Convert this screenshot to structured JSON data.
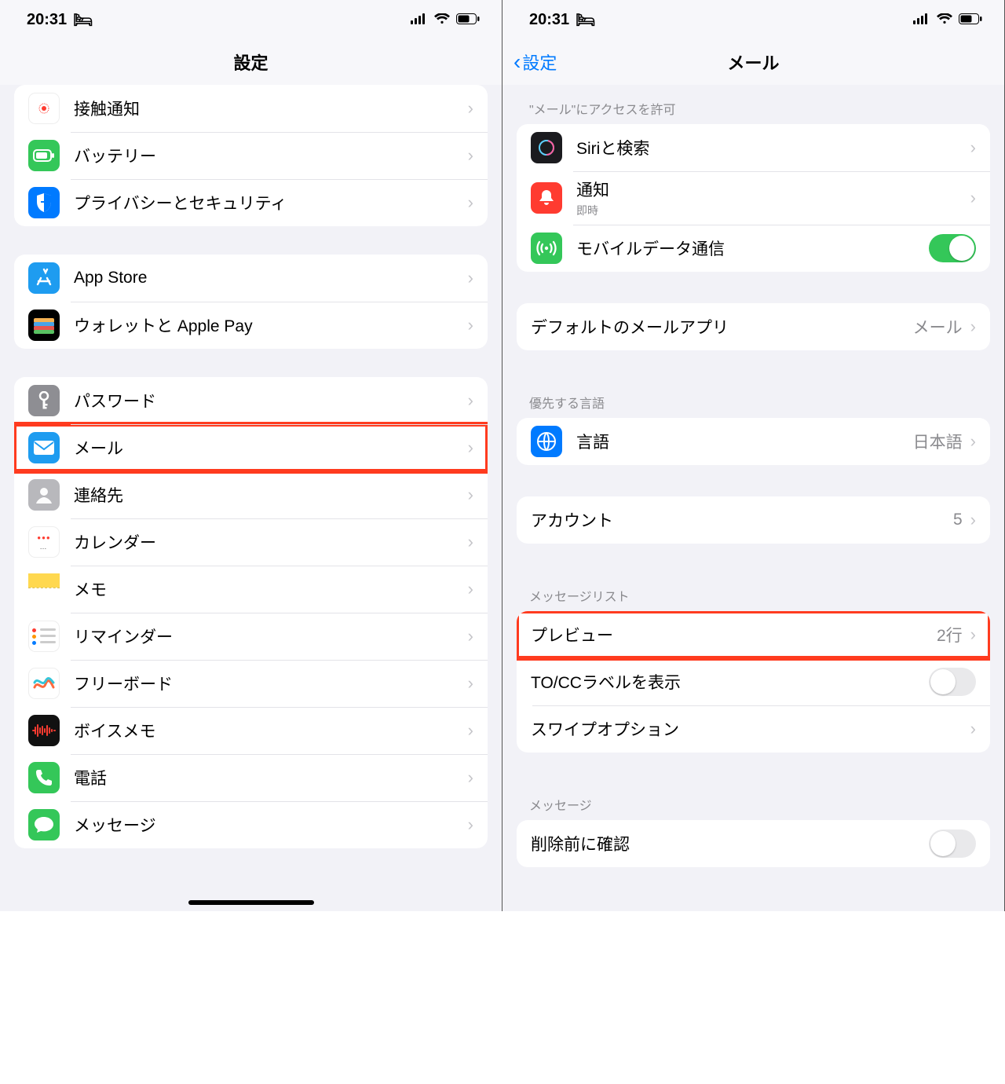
{
  "status": {
    "time": "20:31"
  },
  "left": {
    "title": "設定",
    "groups": [
      {
        "rows": [
          {
            "icon": "exposure",
            "label": "接触通知"
          },
          {
            "icon": "battery",
            "label": "バッテリー"
          },
          {
            "icon": "privacy",
            "label": "プライバシーとセキュリティ"
          }
        ]
      },
      {
        "rows": [
          {
            "icon": "appstore",
            "label": "App Store"
          },
          {
            "icon": "wallet",
            "label": "ウォレットと Apple Pay"
          }
        ]
      },
      {
        "rows": [
          {
            "icon": "passwords",
            "label": "パスワード"
          },
          {
            "icon": "mail",
            "label": "メール",
            "highlight": true
          },
          {
            "icon": "contacts",
            "label": "連絡先"
          },
          {
            "icon": "calendar",
            "label": "カレンダー"
          },
          {
            "icon": "notes",
            "label": "メモ"
          },
          {
            "icon": "reminders",
            "label": "リマインダー"
          },
          {
            "icon": "freeform",
            "label": "フリーボード"
          },
          {
            "icon": "voicememos",
            "label": "ボイスメモ"
          },
          {
            "icon": "phone",
            "label": "電話"
          },
          {
            "icon": "messages",
            "label": "メッセージ"
          }
        ]
      }
    ]
  },
  "right": {
    "back": "設定",
    "title": "メール",
    "sections": [
      {
        "header": "\"メール\"にアクセスを許可",
        "rows": [
          {
            "icon": "siri",
            "label": "Siriと検索",
            "type": "disclosure"
          },
          {
            "icon": "notif",
            "label": "通知",
            "sublabel": "即時",
            "type": "disclosure"
          },
          {
            "icon": "cellular",
            "label": "モバイルデータ通信",
            "type": "toggle",
            "toggle": true
          }
        ]
      },
      {
        "header": "",
        "rows": [
          {
            "label": "デフォルトのメールアプリ",
            "value": "メール",
            "type": "disclosure",
            "noicon": true
          }
        ]
      },
      {
        "header": "優先する言語",
        "rows": [
          {
            "icon": "lang",
            "label": "言語",
            "value": "日本語",
            "type": "disclosure"
          }
        ]
      },
      {
        "header": "",
        "rows": [
          {
            "label": "アカウント",
            "value": "5",
            "type": "disclosure",
            "noicon": true
          }
        ]
      },
      {
        "header": "メッセージリスト",
        "rows": [
          {
            "label": "プレビュー",
            "value": "2行",
            "type": "disclosure",
            "noicon": true,
            "highlight": true
          },
          {
            "label": "TO/CCラベルを表示",
            "type": "toggle",
            "toggle": false,
            "noicon": true
          },
          {
            "label": "スワイプオプション",
            "type": "disclosure",
            "noicon": true
          }
        ]
      },
      {
        "header": "メッセージ",
        "rows": [
          {
            "label": "削除前に確認",
            "type": "toggle",
            "toggle": false,
            "noicon": true
          }
        ]
      }
    ]
  }
}
